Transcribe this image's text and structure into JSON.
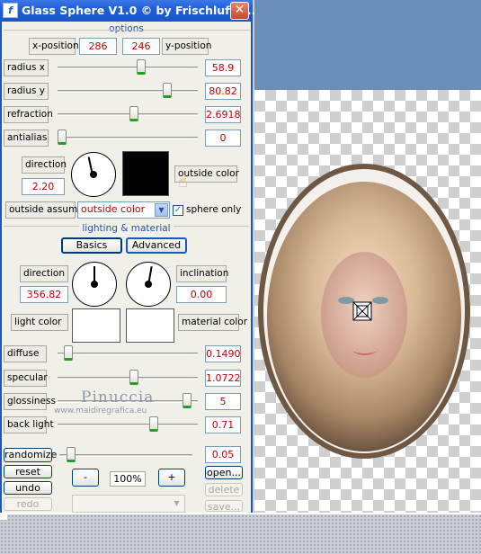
{
  "window": {
    "title": "Glass Sphere V1.0 © by Frischluft i...",
    "app_icon": "f",
    "close": "✕"
  },
  "options": {
    "header": "options",
    "x_label": "x-position",
    "x_value": "286",
    "y_value": "246",
    "y_label": "y-position",
    "sliders": [
      {
        "label": "radius x",
        "value": "58.9",
        "fraction": 0.6
      },
      {
        "label": "radius y",
        "value": "80.82",
        "fraction": 0.8
      },
      {
        "label": "refraction",
        "value": "2.6918",
        "fraction": 0.55
      },
      {
        "label": "antialias",
        "value": "0",
        "fraction": 0.0
      }
    ],
    "direction_label": "direction",
    "direction_value": "2.20",
    "outside_color_label": "outside color",
    "outside_assume_label": "outside assume",
    "outside_assume_value": "outside color",
    "sphere_only_label": "sphere only",
    "sphere_only_checked": true
  },
  "lighting": {
    "header": "lighting & material",
    "tab_basics": "Basics",
    "tab_advanced": "Advanced",
    "direction_label": "direction",
    "direction_value": "356.82",
    "inclination_label": "inclination",
    "inclination_value": "0.00",
    "light_color_label": "light color",
    "material_color_label": "material color",
    "sliders": [
      {
        "label": "diffuse",
        "value": "0.1490",
        "fraction": 0.05
      },
      {
        "label": "specular",
        "value": "1.0722",
        "fraction": 0.55
      },
      {
        "label": "glossiness",
        "value": "5",
        "fraction": 0.95
      },
      {
        "label": "back light",
        "value": "0.71",
        "fraction": 0.7
      }
    ]
  },
  "controls": {
    "randomize": "randomize",
    "randomize_value": "0.05",
    "reset": "reset",
    "undo": "undo",
    "redo": "redo",
    "zoom_out": "-",
    "zoom_value": "100%",
    "zoom_in": "+",
    "open": "open...",
    "delete": "delete",
    "save": "save..."
  },
  "watermark": {
    "line1": "Pinuccia",
    "line2": "www.maidiregrafica.eu"
  },
  "colors": {
    "outside_color": "#000000",
    "light_color": "#ffffff",
    "material_color": "#ffffff",
    "accent": "#1f5fd8"
  }
}
